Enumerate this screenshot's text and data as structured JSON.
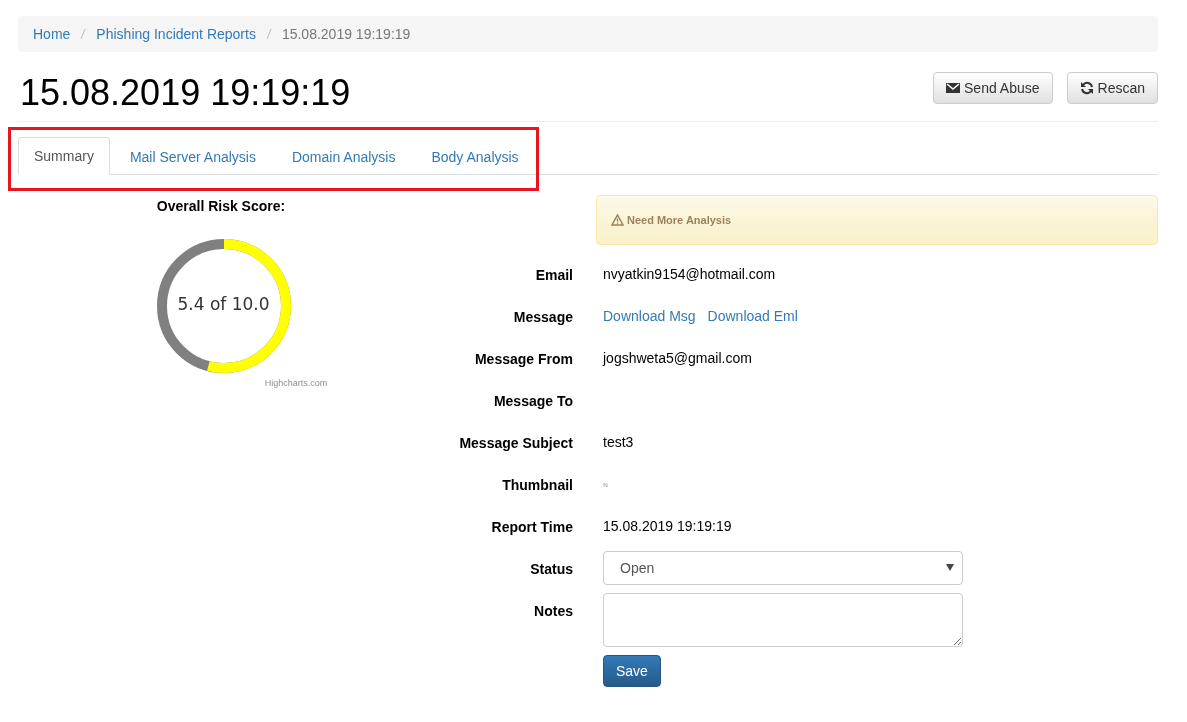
{
  "breadcrumb": [
    {
      "label": "Home",
      "kind": "link"
    },
    {
      "label": "Phishing Incident Reports",
      "kind": "link"
    },
    {
      "label": "15.08.2019 19:19:19",
      "kind": "current"
    }
  ],
  "title": "15.08.2019 19:19:19",
  "actions": [
    {
      "label": "Send Abuse",
      "kind": "mail"
    },
    {
      "label": "Rescan",
      "kind": "refresh"
    }
  ],
  "tabs": [
    {
      "label": "Summary",
      "selected": true
    },
    {
      "label": "Mail Server Analysis",
      "selected": false
    },
    {
      "label": "Domain Analysis",
      "selected": false
    },
    {
      "label": "Body Analysis",
      "selected": false
    }
  ],
  "risk": {
    "heading": "Overall Risk Score:",
    "level": 0.54,
    "reading": "5.4 of 10.0",
    "credit": "Highcharts.com"
  },
  "alert": {
    "text": "Need More Analysis"
  },
  "details": [
    {
      "label": "Email",
      "kind": "text",
      "value": "nvyatkin9154@hotmail.com"
    },
    {
      "label": "Message",
      "kind": "links",
      "links": [
        "Download Msg",
        "Download Eml"
      ]
    },
    {
      "label": "Message From",
      "kind": "text",
      "value": "jogshweta5@gmail.com"
    },
    {
      "label": "Message To",
      "kind": "empty"
    },
    {
      "label": "Message Subject",
      "kind": "text",
      "value": "test3"
    },
    {
      "label": "Thumbnail",
      "kind": "image"
    },
    {
      "label": "Report Time",
      "kind": "text",
      "value": "15.08.2019 19:19:19"
    },
    {
      "label": "Status",
      "kind": "select",
      "value": "Open"
    },
    {
      "label": "Notes",
      "kind": "textarea"
    }
  ],
  "save_button": "Save"
}
